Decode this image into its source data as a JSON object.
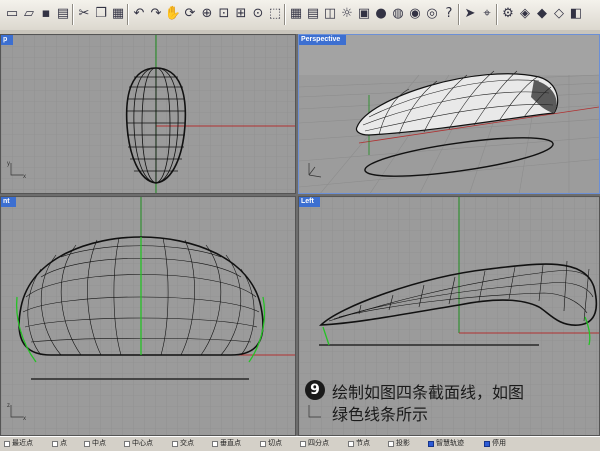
{
  "toolbar": {
    "icons": [
      "new-file-icon",
      "open-folder-icon",
      "save-icon",
      "print-icon",
      "cut-icon",
      "copy-icon",
      "paste-icon",
      "undo-icon",
      "redo-icon",
      "pan-hand-icon",
      "rotate-icon",
      "zoom-icon",
      "zoom-window-icon",
      "zoom-extents-icon",
      "zoom-selected-icon",
      "select-icon",
      "grid-icon",
      "layers-icon",
      "properties-icon",
      "light-icon",
      "lock-icon",
      "render-sphere-icon",
      "shaded-sphere-icon",
      "material-sphere-icon",
      "wire-sphere-icon",
      "help-icon",
      "arrow-icon",
      "snap-icon",
      "options-icon",
      "palette-icon",
      "tag-icon",
      "bulb-icon",
      "box-icon"
    ]
  },
  "viewports": {
    "top": {
      "title": "Top",
      "title_visible": "p"
    },
    "perspective": {
      "title": "Perspective"
    },
    "front": {
      "title": "nt"
    },
    "left": {
      "title": "Left"
    }
  },
  "caption": {
    "step": "9",
    "line1": "绘制如图四条截面线，如图",
    "line2": "绿色线条所示"
  },
  "statusbar": {
    "snaps": [
      {
        "label": "最近点",
        "on": false
      },
      {
        "label": "点",
        "on": false
      },
      {
        "label": "中点",
        "on": false
      },
      {
        "label": "中心点",
        "on": false
      },
      {
        "label": "交点",
        "on": false
      },
      {
        "label": "垂直点",
        "on": false
      },
      {
        "label": "切点",
        "on": false
      },
      {
        "label": "四分点",
        "on": false
      },
      {
        "label": "节点",
        "on": false
      },
      {
        "label": "投影",
        "on": false
      },
      {
        "label": "智慧轨迹",
        "on": true
      },
      {
        "label": "停用",
        "on": true
      }
    ]
  },
  "colors": {
    "viewport_bg": "#9a9a9a",
    "grid": "#8a8a8a",
    "axis_x": "#b03030",
    "axis_y": "#1c8c1c",
    "active_title": "#3c6fd1",
    "section_curve": "#25c225"
  }
}
